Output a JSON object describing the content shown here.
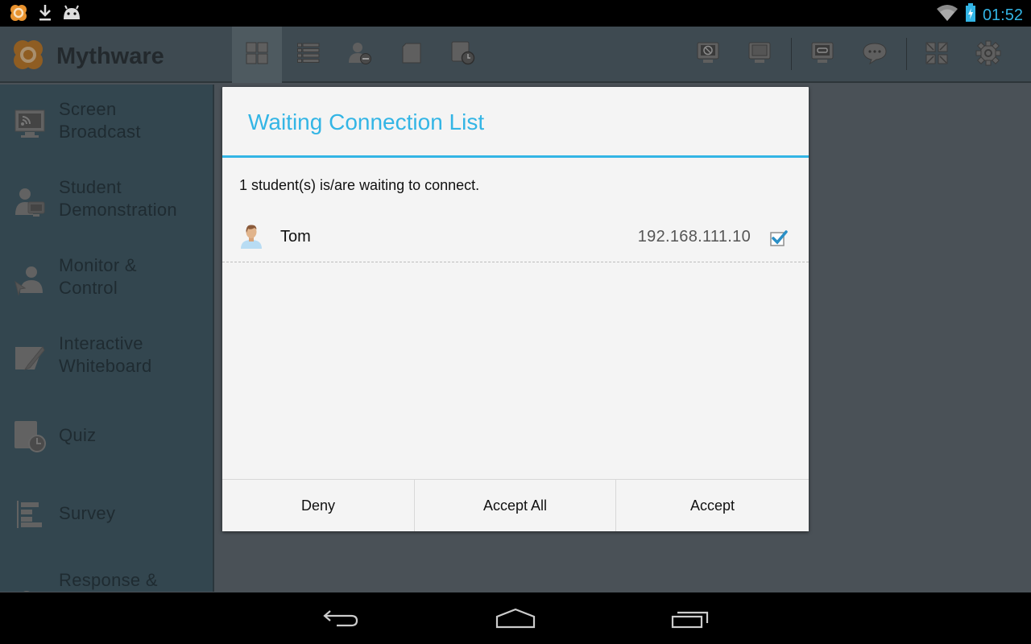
{
  "status_bar": {
    "notification_icons": [
      "mythware-icon",
      "download-icon",
      "android-icon"
    ],
    "wifi": "wifi-icon",
    "battery": "battery-charging-icon",
    "time": "01:52"
  },
  "app": {
    "name": "Mythware",
    "toolbar_left": [
      {
        "name": "grid-view",
        "icon": "grid-icon",
        "active": true
      },
      {
        "name": "list-view",
        "icon": "list-icon",
        "active": false
      },
      {
        "name": "remove-student",
        "icon": "user-minus-icon",
        "active": false
      },
      {
        "name": "document",
        "icon": "document-icon",
        "active": false
      },
      {
        "name": "quiz-timer",
        "icon": "document-clock-icon",
        "active": false
      }
    ],
    "toolbar_right": [
      {
        "name": "black-screen",
        "icon": "monitor-blocked-icon"
      },
      {
        "name": "unblack-screen",
        "icon": "monitor-icon"
      },
      {
        "name": "remote-link",
        "icon": "monitor-link-icon"
      },
      {
        "name": "message",
        "icon": "chat-bubble-icon"
      },
      {
        "name": "collapse",
        "icon": "collapse-arrows-icon"
      },
      {
        "name": "settings",
        "icon": "gear-icon"
      }
    ]
  },
  "sidebar": {
    "items": [
      {
        "line1": "Screen",
        "line2": "Broadcast",
        "icon": "screen-broadcast-icon"
      },
      {
        "line1": "Student",
        "line2": "Demonstration",
        "icon": "student-demo-icon"
      },
      {
        "line1": "Monitor &",
        "line2": "Control",
        "icon": "monitor-control-icon"
      },
      {
        "line1": "Interactive",
        "line2": "Whiteboard",
        "icon": "whiteboard-icon"
      },
      {
        "line1": "Quiz",
        "line2": "",
        "icon": "quiz-icon"
      },
      {
        "line1": "Survey",
        "line2": "",
        "icon": "survey-icon"
      },
      {
        "line1": "Response &",
        "line2": "",
        "icon": "response-icon"
      }
    ]
  },
  "dialog": {
    "title": "Waiting Connection List",
    "message": "1 student(s) is/are waiting to connect.",
    "students": [
      {
        "name": "Tom",
        "ip": "192.168.111.10",
        "checked": true
      }
    ],
    "buttons": {
      "deny": "Deny",
      "accept_all": "Accept All",
      "accept": "Accept"
    }
  },
  "colors": {
    "accent": "#33b5e5",
    "dialog_bg": "#f4f4f4",
    "sidebar_bg": "#33464f"
  },
  "nav_bar": {
    "buttons": [
      "back-icon",
      "home-icon",
      "recent-apps-icon"
    ]
  }
}
